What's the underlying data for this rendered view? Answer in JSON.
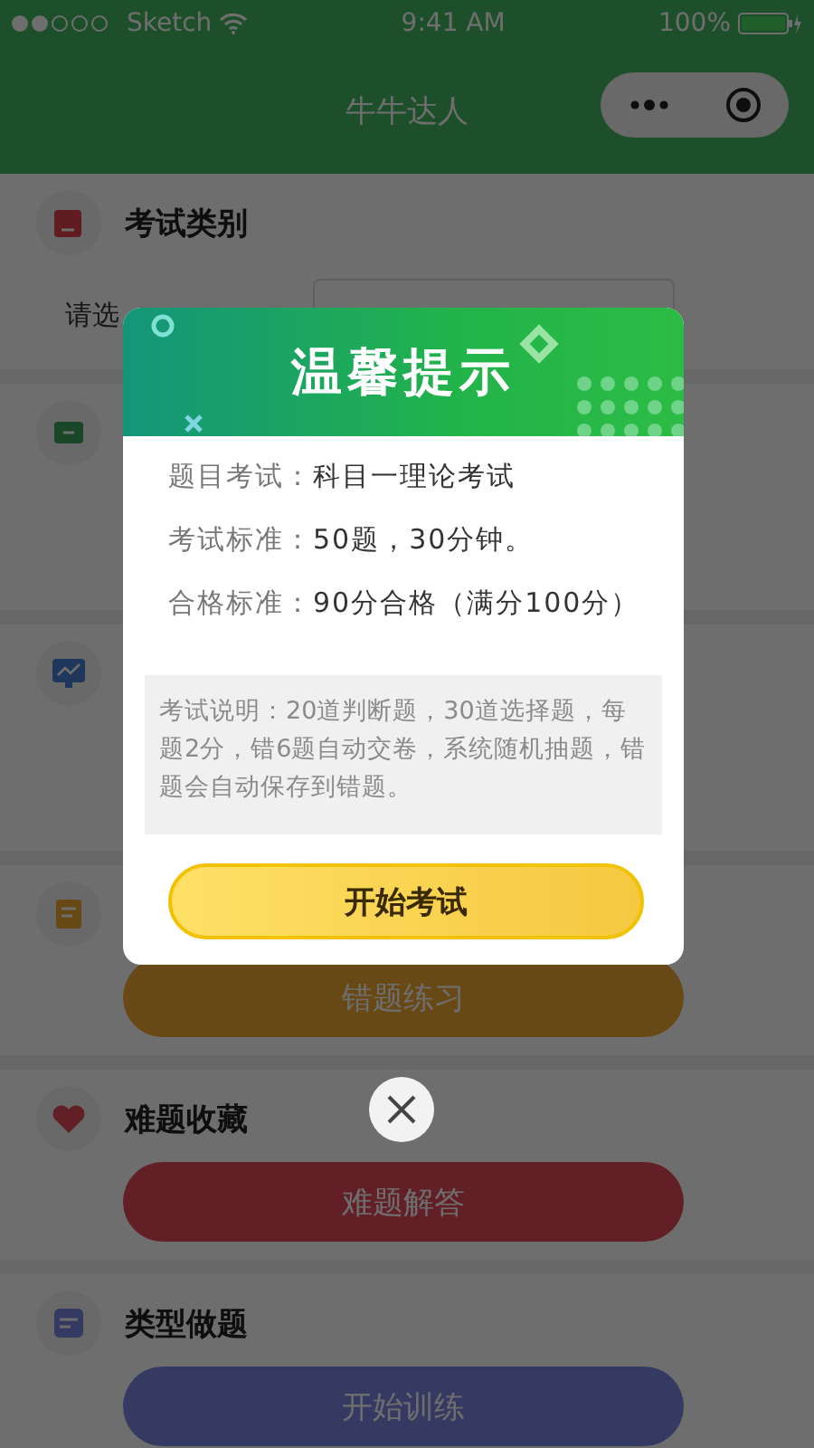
{
  "status_bar": {
    "carrier": "Sketch",
    "time": "9:41 AM",
    "battery": "100%"
  },
  "nav": {
    "title": "牛牛达人"
  },
  "sections": [
    {
      "kind": "field",
      "title": "考试类别",
      "label": "请选"
    },
    {
      "kind": "blank"
    },
    {
      "kind": "blank"
    },
    {
      "kind": "button",
      "button": "错题练习"
    },
    {
      "kind": "button",
      "title": "难题收藏",
      "button": "难题解答"
    },
    {
      "kind": "button",
      "title": "类型做题",
      "button": "开始训练"
    }
  ],
  "dialog": {
    "title": "温馨提示",
    "rows": [
      {
        "label": "题目考试：",
        "value": "科目一理论考试"
      },
      {
        "label": "考试标准：",
        "value": "50题，30分钟。"
      },
      {
        "label": "合格标准：",
        "value": "90分合格（满分100分）"
      }
    ],
    "note": "考试说明：20道判断题，30道选择题，每题2分，错6题自动交卷，系统随机抽题，错题会自动保存到错题。",
    "button": "开始考试"
  }
}
